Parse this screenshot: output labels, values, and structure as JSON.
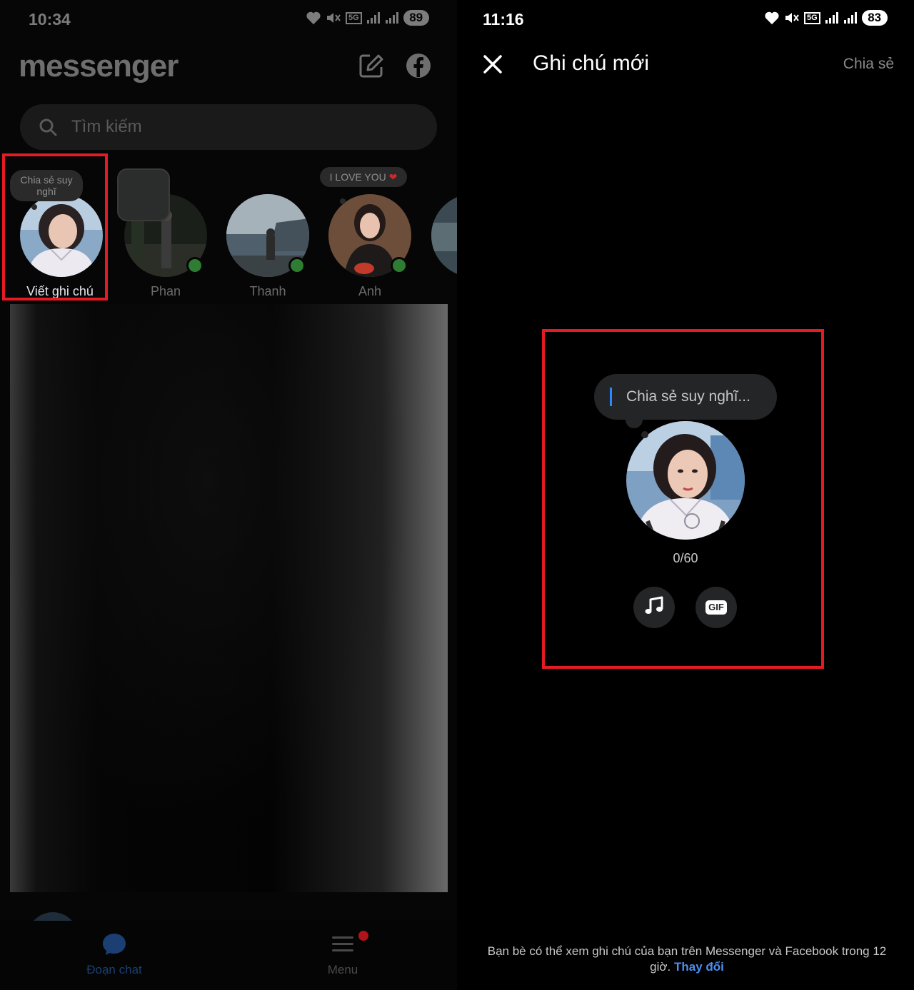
{
  "left": {
    "status": {
      "time": "10:34",
      "battery": "89",
      "net": "5G"
    },
    "brand": "messenger",
    "search": {
      "placeholder": "Tìm kiếm"
    },
    "notes": [
      {
        "name": "Viết ghi chú",
        "bubble": "Chia sẻ suy nghĩ",
        "online": false
      },
      {
        "name": "Phan",
        "bubble": "",
        "online": true
      },
      {
        "name": "Thanh",
        "bubble": "",
        "online": true
      },
      {
        "name": "Anh",
        "bubble": "I LOVE YOU",
        "online": true
      }
    ],
    "nav": {
      "chats_label": "Đoạn chat",
      "menu_label": "Menu"
    }
  },
  "right": {
    "status": {
      "time": "11:16",
      "battery": "83",
      "net": "5G"
    },
    "title": "Ghi chú mới",
    "share_label": "Chia sẻ",
    "compose_placeholder": "Chia sẻ suy nghĩ...",
    "counter": "0/60",
    "gif_label": "GIF",
    "footer_text": "Bạn bè có thể xem ghi chú của bạn trên Messenger và Facebook trong 12 giờ.",
    "footer_link": "Thay đổi"
  },
  "colors": {
    "accent_blue": "#2d88ff",
    "highlight_red": "#e51b23",
    "online_green": "#2e7d32"
  },
  "icons": [
    "heart-icon",
    "mute-icon",
    "signal-icon",
    "compose-icon",
    "facebook-icon",
    "search-icon",
    "close-icon",
    "music-icon",
    "gif-icon",
    "chat-bubble-icon",
    "menu-icon"
  ]
}
